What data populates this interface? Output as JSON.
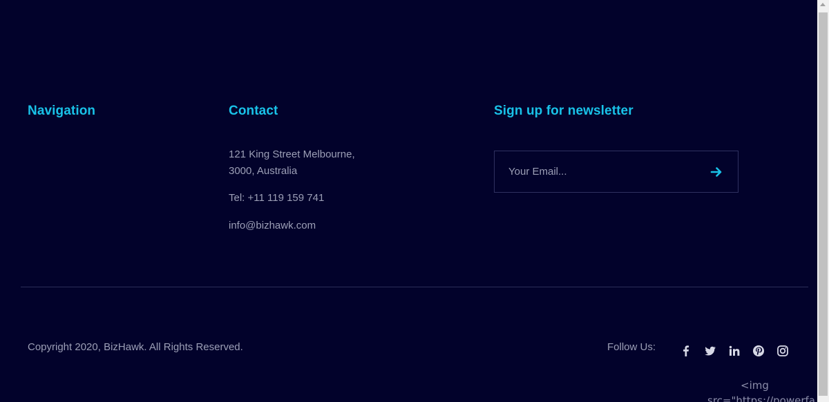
{
  "footer": {
    "navigation_heading": "Navigation",
    "contact_heading": "Contact",
    "newsletter_heading": "Sign up for newsletter",
    "contact": {
      "address_line1": "121 King Street Melbourne,",
      "address_line2": "3000, Australia",
      "tel": "Tel: +11 119 159 741",
      "email": "info@bizhawk.com"
    },
    "newsletter": {
      "email_placeholder": "Your Email...",
      "submit_icon": "arrow-right-icon"
    },
    "copyright": "Copyright 2020, BizHawk. All Rights Reserved.",
    "follow_label": "Follow Us:",
    "social_icons": [
      "facebook-icon",
      "twitter-icon",
      "linkedin-icon",
      "pinterest-icon",
      "instagram-icon"
    ],
    "stray_code_line1": "<img",
    "stray_code_line2": "src=\"https://powerfa"
  },
  "colors": {
    "background": "#02022b",
    "accent": "#19c2e8",
    "text_muted": "#9c9fb6",
    "divider": "#2b2d58"
  }
}
